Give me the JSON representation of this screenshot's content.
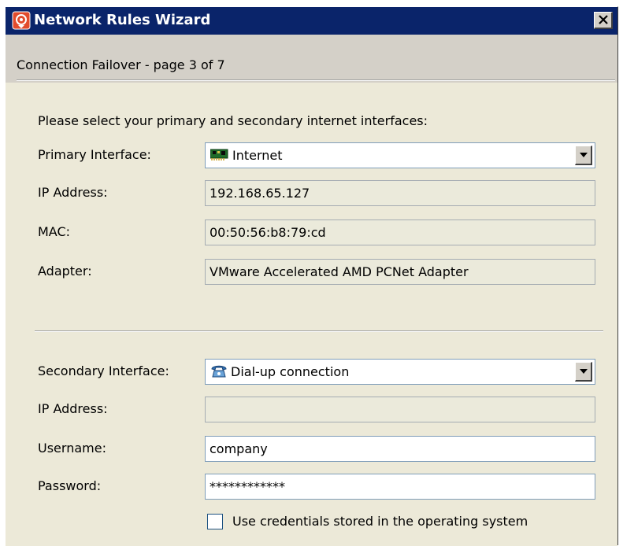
{
  "window": {
    "title": "Network Rules Wizard",
    "app_icon": "network-rules-app-icon",
    "close_icon": "close-icon"
  },
  "header": {
    "page_label": "Connection Failover - page 3 of 7"
  },
  "instructions": "Please select your primary and secondary internet interfaces:",
  "primary": {
    "label": "Primary Interface:",
    "selected": "Internet",
    "icon": "network-card-icon",
    "ip_label": "IP Address:",
    "ip_value": "192.168.65.127",
    "mac_label": "MAC:",
    "mac_value": "00:50:56:b8:79:cd",
    "adapter_label": "Adapter:",
    "adapter_value": "VMware Accelerated AMD PCNet Adapter"
  },
  "secondary": {
    "label": "Secondary Interface:",
    "selected": "Dial-up connection",
    "icon": "dialup-phone-icon",
    "ip_label": "IP Address:",
    "ip_value": "",
    "username_label": "Username:",
    "username_value": "company",
    "password_label": "Password:",
    "password_value": "************",
    "use_credentials_label": "Use credentials stored in the operating system",
    "use_credentials_checked": false
  },
  "colors": {
    "titlebar": "#0a246a",
    "header_bg": "#d4d0c8",
    "content_bg": "#ece9d8",
    "readonly_field": "#ebeadb"
  }
}
